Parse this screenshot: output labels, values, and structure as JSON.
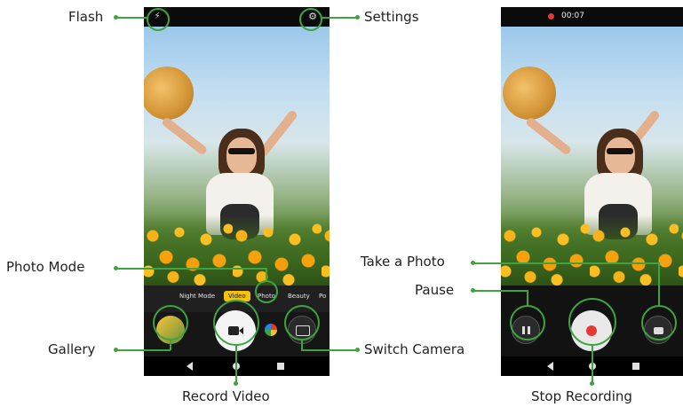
{
  "left_phone": {
    "modes": [
      "Night Mode",
      "Video",
      "Photo",
      "Beauty",
      "Po"
    ],
    "active_mode": "Video",
    "status_icons": {
      "flash": "flash-off-icon",
      "settings": "gear-icon"
    },
    "buttons": {
      "gallery": "gallery-thumbnail",
      "record": "video-camera-icon",
      "switch_camera": "camera-switch-icon"
    }
  },
  "right_phone": {
    "status": {
      "recording_time": "00:07",
      "recording_dot_color": "#e53935"
    },
    "buttons": {
      "pause": "pause-icon",
      "stop": "stop-record-icon",
      "snapshot": "camera-icon"
    }
  },
  "callouts": {
    "flash": "Flash",
    "settings": "Settings",
    "photo_mode": "Photo Mode",
    "gallery": "Gallery",
    "switch_camera": "Switch Camera",
    "record_video": "Record Video",
    "take_photo": "Take a Photo",
    "pause": "Pause",
    "stop_recording": "Stop Recording"
  },
  "colors": {
    "accent_green": "#3fa33f",
    "mode_active": "#f4c20d",
    "record_red": "#e53935"
  }
}
